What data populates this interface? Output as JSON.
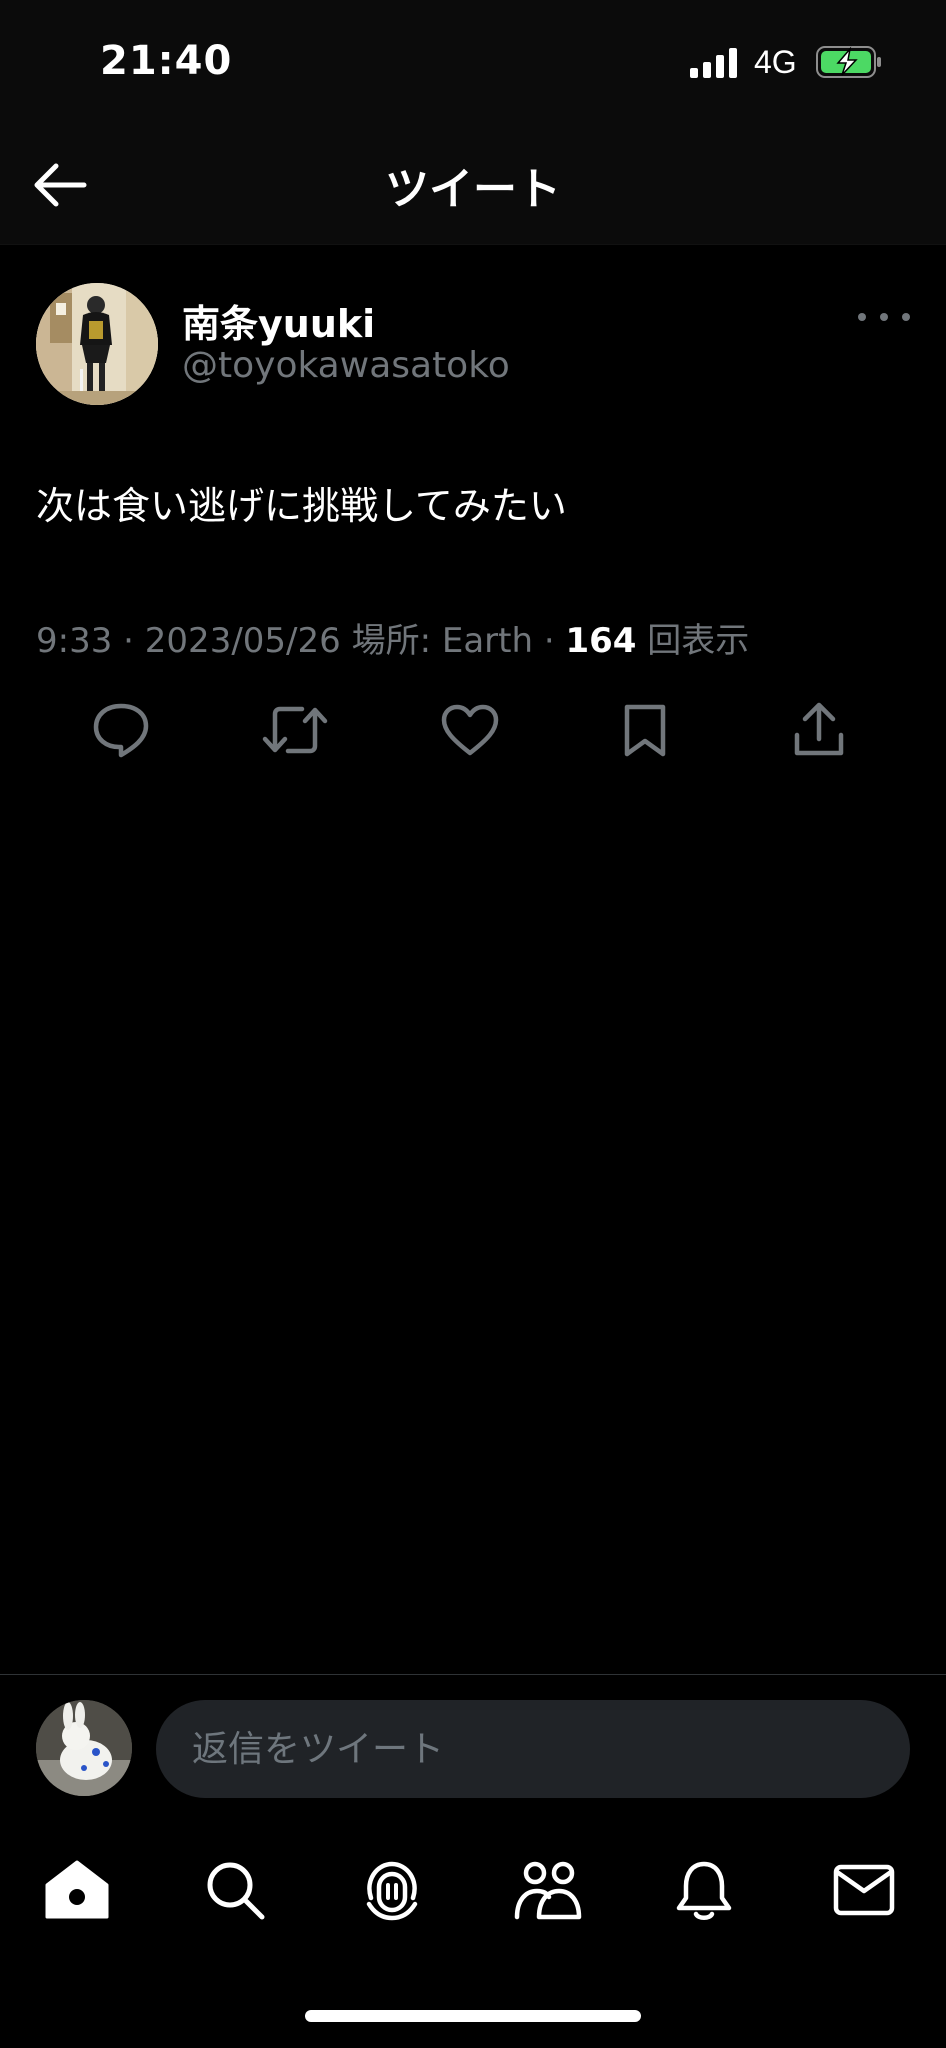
{
  "status_bar": {
    "time": "21:40",
    "network": "4G"
  },
  "header": {
    "title": "ツイート"
  },
  "tweet": {
    "author_name": "南条yuuki",
    "author_handle": "@toyokawasatoko",
    "text": "次は食い逃げに挑戦してみたい",
    "time": "9:33",
    "date": "2023/05/26",
    "location": "場所: Earth",
    "view_count": "164",
    "view_label": "回表示"
  },
  "reply": {
    "placeholder": "返信をツイート"
  },
  "icons": {
    "back": "back-arrow-icon",
    "more": "more-icon",
    "reply": "reply-icon",
    "retweet": "retweet-icon",
    "like": "heart-icon",
    "bookmark": "bookmark-icon",
    "share": "share-icon",
    "tabs": [
      "home-icon",
      "search-icon",
      "spaces-icon",
      "communities-icon",
      "notifications-icon",
      "messages-icon"
    ]
  },
  "colors": {
    "background": "#000000",
    "text": "#e7e9ea",
    "secondary": "#71767b",
    "input_bg": "#202327",
    "battery_charge": "#4cd964"
  }
}
